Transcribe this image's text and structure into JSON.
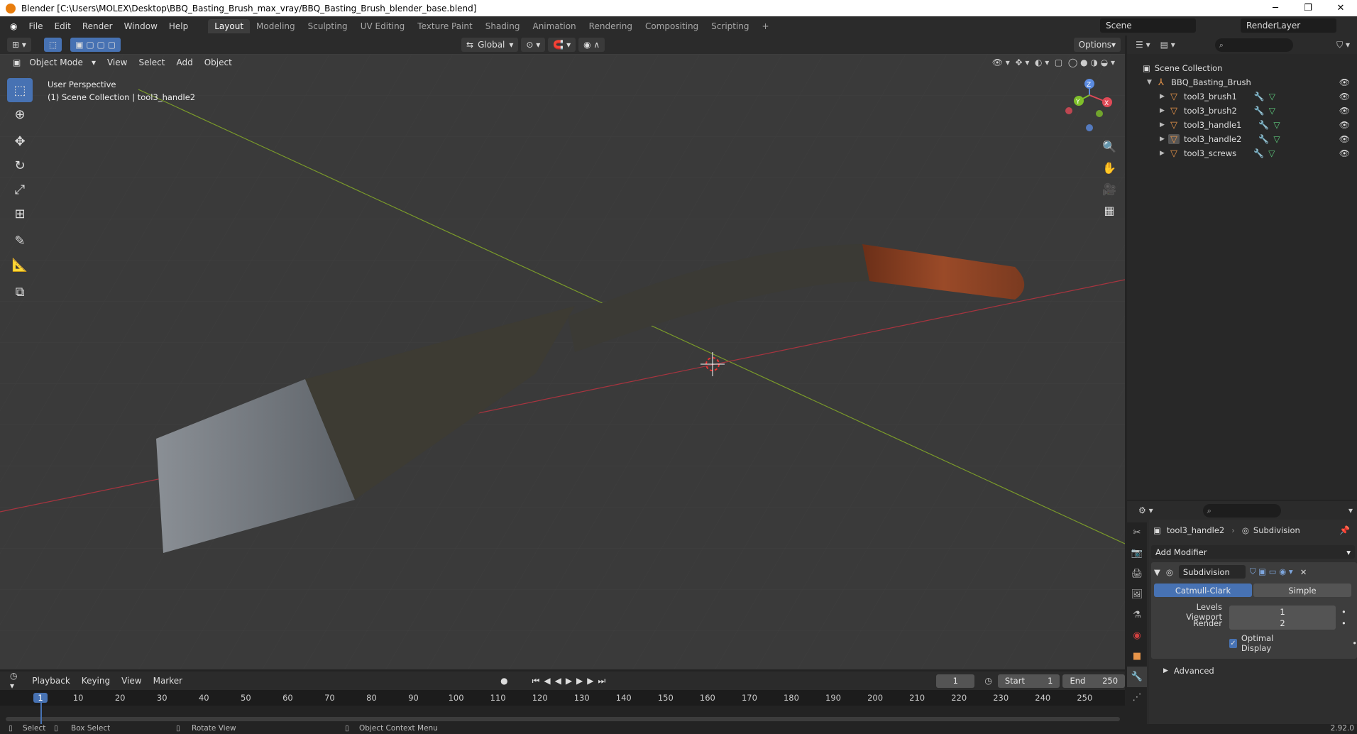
{
  "window": {
    "title": "Blender [C:\\Users\\MOLEX\\Desktop\\BBQ_Basting_Brush_max_vray/BBQ_Basting_Brush_blender_base.blend]",
    "minimize": "─",
    "maximize": "❐",
    "close": "✕"
  },
  "menu": [
    "File",
    "Edit",
    "Render",
    "Window",
    "Help"
  ],
  "workspaces": [
    "Layout",
    "Modeling",
    "Sculpting",
    "UV Editing",
    "Texture Paint",
    "Shading",
    "Animation",
    "Rendering",
    "Compositing",
    "Scripting"
  ],
  "active_workspace": "Layout",
  "add_workspace": "+",
  "scene": "Scene",
  "view_layer": "RenderLayer",
  "viewport": {
    "transform_orientation": "Global",
    "options": "Options",
    "mode": "Object Mode",
    "menus": [
      "View",
      "Select",
      "Add",
      "Object"
    ],
    "info_line1": "User Perspective",
    "info_line2": "(1) Scene Collection | tool3_handle2",
    "gizmo_x": "X",
    "gizmo_y": "Y",
    "gizmo_z": "Z"
  },
  "outliner": {
    "root": "Scene Collection",
    "collection": "BBQ_Basting_Brush",
    "items": [
      {
        "name": "tool3_brush1"
      },
      {
        "name": "tool3_brush2"
      },
      {
        "name": "tool3_handle1"
      },
      {
        "name": "tool3_handle2"
      },
      {
        "name": "tool3_screws"
      }
    ]
  },
  "properties": {
    "object": "tool3_handle2",
    "modifier_tab": "Subdivision",
    "add_modifier": "Add Modifier",
    "modifier_name": "Subdivision",
    "mode_a": "Catmull-Clark",
    "mode_b": "Simple",
    "levels_viewport_label": "Levels Viewport",
    "levels_viewport": "1",
    "render_label": "Render",
    "render": "2",
    "optimal_display": "Optimal Display",
    "advanced": "Advanced"
  },
  "timeline": {
    "menus": [
      "Playback",
      "Keying",
      "View",
      "Marker"
    ],
    "current_frame": "1",
    "start_label": "Start",
    "start": "1",
    "end_label": "End",
    "end": "250",
    "ticks": [
      "1",
      "10",
      "20",
      "30",
      "40",
      "50",
      "60",
      "70",
      "80",
      "90",
      "100",
      "110",
      "120",
      "130",
      "140",
      "150",
      "160",
      "170",
      "180",
      "190",
      "200",
      "210",
      "220",
      "230",
      "240",
      "250"
    ]
  },
  "status": {
    "select": "Select",
    "box_select": "Box Select",
    "rotate_view": "Rotate View",
    "context_menu": "Object Context Menu",
    "version": "2.92.0"
  }
}
